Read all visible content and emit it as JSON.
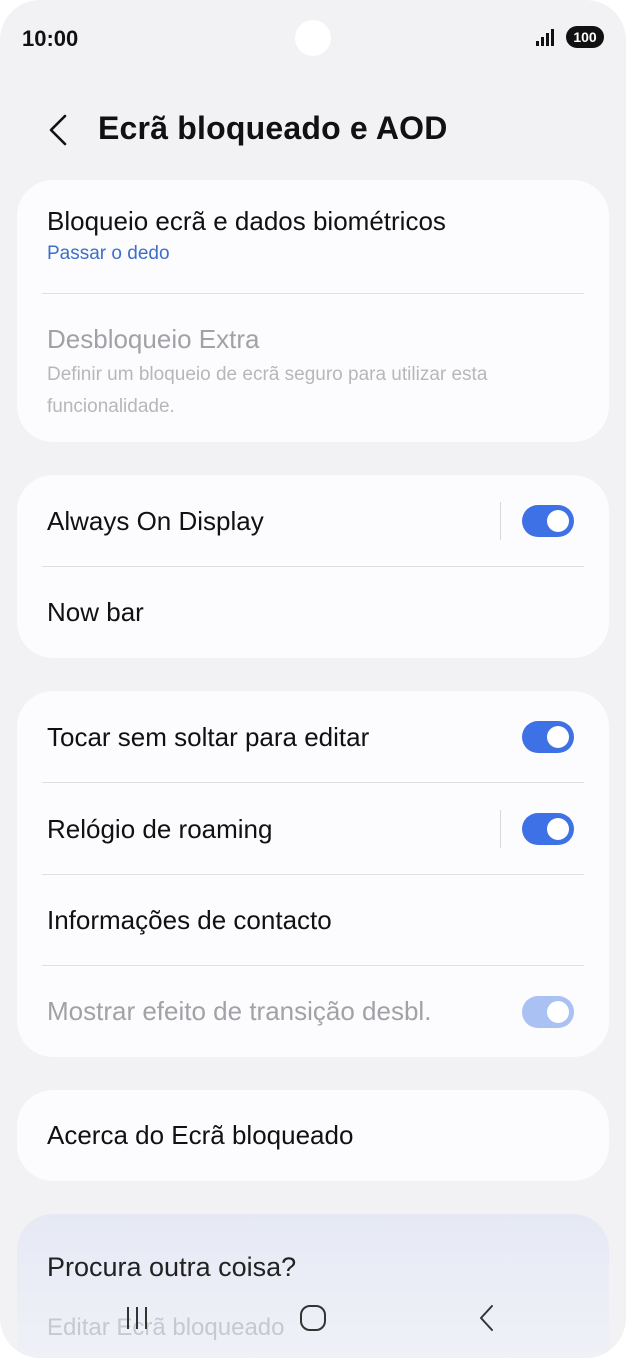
{
  "status_bar": {
    "time": "10:00",
    "battery": "100",
    "signal_icon": "signal-bars-icon"
  },
  "header": {
    "title": "Ecrã bloqueado e AOD",
    "back_icon": "chevron-left-icon"
  },
  "card_security": {
    "lock_screen": {
      "title": "Bloqueio ecrã e dados biométricos",
      "subtitle": "Passar o dedo"
    },
    "extra_unlock": {
      "title": "Desbloqueio Extra",
      "subtitle": "Definir um bloqueio de ecrã seguro para utilizar esta funcionalidade."
    }
  },
  "card_display": {
    "aod": {
      "title": "Always On Display",
      "enabled": true
    },
    "now_bar": {
      "title": "Now bar"
    }
  },
  "card_options": {
    "touch_hold": {
      "title": "Tocar sem soltar para editar",
      "enabled": true
    },
    "roaming_clock": {
      "title": "Relógio de roaming",
      "enabled": true
    },
    "contact_info": {
      "title": "Informações de contacto"
    },
    "transition_effect": {
      "title": "Mostrar efeito de transição desbl.",
      "enabled": true,
      "disabled": true
    }
  },
  "card_about": {
    "title": "Acerca do Ecrã bloqueado"
  },
  "search_suggestions": {
    "title": "Procura outra coisa?",
    "link": "Editar Ecrã bloqueado"
  },
  "nav_bar": {
    "recents_icon": "recents-icon",
    "home_icon": "home-icon",
    "back_icon": "back-icon"
  },
  "colors": {
    "accent": "#3e70e6",
    "link": "#3e6fc8",
    "background": "#f2f2f5",
    "card": "#fcfcfe"
  }
}
